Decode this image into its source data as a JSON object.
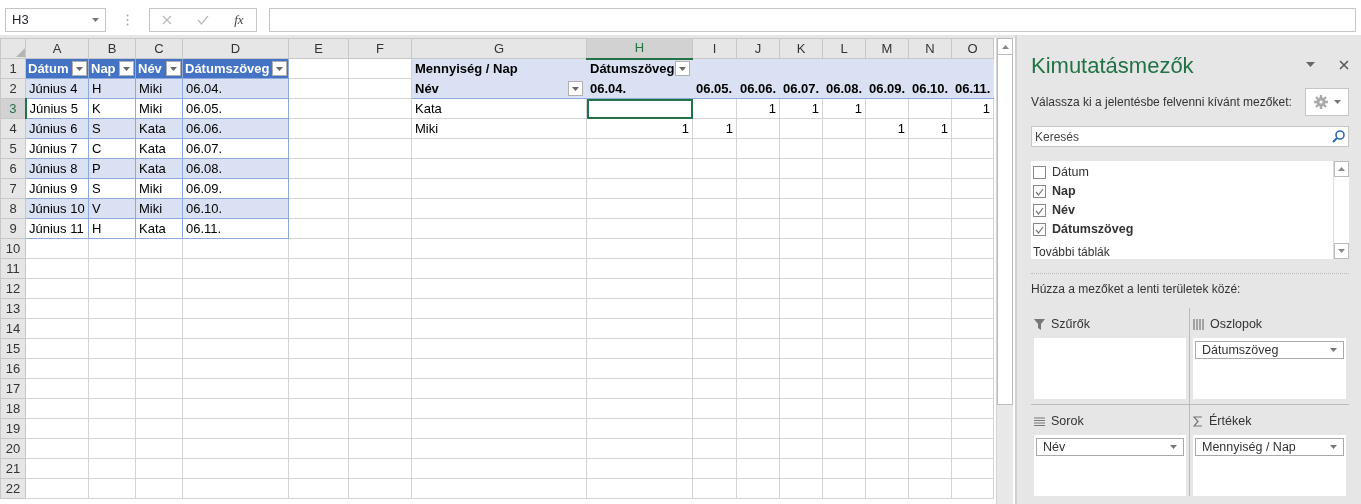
{
  "formula_bar": {
    "name_box": "H3",
    "function_label": "fx"
  },
  "sheet": {
    "columns": [
      {
        "label": "A",
        "selected": false
      },
      {
        "label": "B",
        "selected": false
      },
      {
        "label": "C",
        "selected": false
      },
      {
        "label": "D",
        "selected": false
      },
      {
        "label": "E",
        "selected": false
      },
      {
        "label": "F",
        "selected": false
      },
      {
        "label": "G",
        "selected": false
      },
      {
        "label": "H",
        "selected": true
      },
      {
        "label": "I",
        "selected": false
      },
      {
        "label": "J",
        "selected": false
      },
      {
        "label": "K",
        "selected": false
      },
      {
        "label": "L",
        "selected": false
      },
      {
        "label": "M",
        "selected": false
      },
      {
        "label": "N",
        "selected": false
      },
      {
        "label": "O",
        "selected": false
      }
    ],
    "rows": [
      {
        "label": "1",
        "selected": false
      },
      {
        "label": "2",
        "selected": false
      },
      {
        "label": "3",
        "selected": true
      },
      {
        "label": "4",
        "selected": false
      },
      {
        "label": "5",
        "selected": false
      },
      {
        "label": "6",
        "selected": false
      },
      {
        "label": "7",
        "selected": false
      },
      {
        "label": "8",
        "selected": false
      },
      {
        "label": "9",
        "selected": false
      },
      {
        "label": "10",
        "selected": false
      },
      {
        "label": "11",
        "selected": false
      },
      {
        "label": "12",
        "selected": false
      },
      {
        "label": "13",
        "selected": false
      },
      {
        "label": "14",
        "selected": false
      },
      {
        "label": "15",
        "selected": false
      },
      {
        "label": "16",
        "selected": false
      },
      {
        "label": "17",
        "selected": false
      },
      {
        "label": "18",
        "selected": false
      },
      {
        "label": "19",
        "selected": false
      },
      {
        "label": "20",
        "selected": false
      },
      {
        "label": "21",
        "selected": false
      },
      {
        "label": "22",
        "selected": false
      }
    ]
  },
  "source_table": {
    "headers": [
      "Dátum",
      "Nap",
      "Név",
      "Dátumszöveg"
    ],
    "rows": [
      [
        "Június 4",
        "H",
        "Miki",
        "06.04."
      ],
      [
        "Június 5",
        "K",
        "Miki",
        "06.05."
      ],
      [
        "Június 6",
        "S",
        "Kata",
        "06.06."
      ],
      [
        "Június 7",
        "C",
        "Kata",
        "06.07."
      ],
      [
        "Június 8",
        "P",
        "Kata",
        "06.08."
      ],
      [
        "Június 9",
        "S",
        "Miki",
        "06.09."
      ],
      [
        "Június 10",
        "V",
        "Miki",
        "06.10."
      ],
      [
        "Június 11",
        "H",
        "Kata",
        "06.11."
      ]
    ]
  },
  "pivot": {
    "value_label": "Mennyiség / Nap",
    "column_field": "Dátumszöveg",
    "row_field": "Név",
    "column_items": [
      "06.04.",
      "06.05.",
      "06.06.",
      "06.07.",
      "06.08.",
      "06.09.",
      "06.10.",
      "06.11."
    ],
    "rows": [
      {
        "label": "Kata",
        "cells": [
          {
            "kind": "empty"
          },
          {
            "kind": "empty"
          },
          {
            "kind": "number",
            "value": "1"
          },
          {
            "kind": "number",
            "value": "1"
          },
          {
            "kind": "number",
            "value": "1"
          },
          {
            "kind": "empty"
          },
          {
            "kind": "empty"
          },
          {
            "kind": "number",
            "value": "1"
          }
        ]
      },
      {
        "label": "Miki",
        "cells": [
          {
            "kind": "number",
            "value": "1"
          },
          {
            "kind": "number",
            "value": "1"
          },
          {
            "kind": "empty"
          },
          {
            "kind": "empty"
          },
          {
            "kind": "empty"
          },
          {
            "kind": "number",
            "value": "1"
          },
          {
            "kind": "number",
            "value": "1"
          },
          {
            "kind": "empty"
          }
        ]
      }
    ]
  },
  "field_panel": {
    "title": "Kimutatásmezők",
    "instruction": "Válassza ki a jelentésbe felvenni kívánt mezőket:",
    "search": {
      "placeholder": "Keresés"
    },
    "fields": [
      {
        "label": "Dátum",
        "checked": false
      },
      {
        "label": "Nap",
        "checked": true
      },
      {
        "label": "Név",
        "checked": true
      },
      {
        "label": "Dátumszöveg",
        "checked": true
      }
    ],
    "more_tables": "További táblák",
    "drag_hint": "Húzza a mezőket a lenti területek közé:",
    "areas": [
      {
        "kind": "filters",
        "label": "Szűrők"
      },
      {
        "kind": "columns",
        "label": "Oszlopok",
        "items": [
          "Dátumszöveg"
        ]
      },
      {
        "kind": "rows",
        "label": "Sorok",
        "items": [
          "Név"
        ]
      },
      {
        "kind": "values",
        "label": "Értékek",
        "items": [
          "Mennyiség / Nap"
        ]
      }
    ]
  }
}
